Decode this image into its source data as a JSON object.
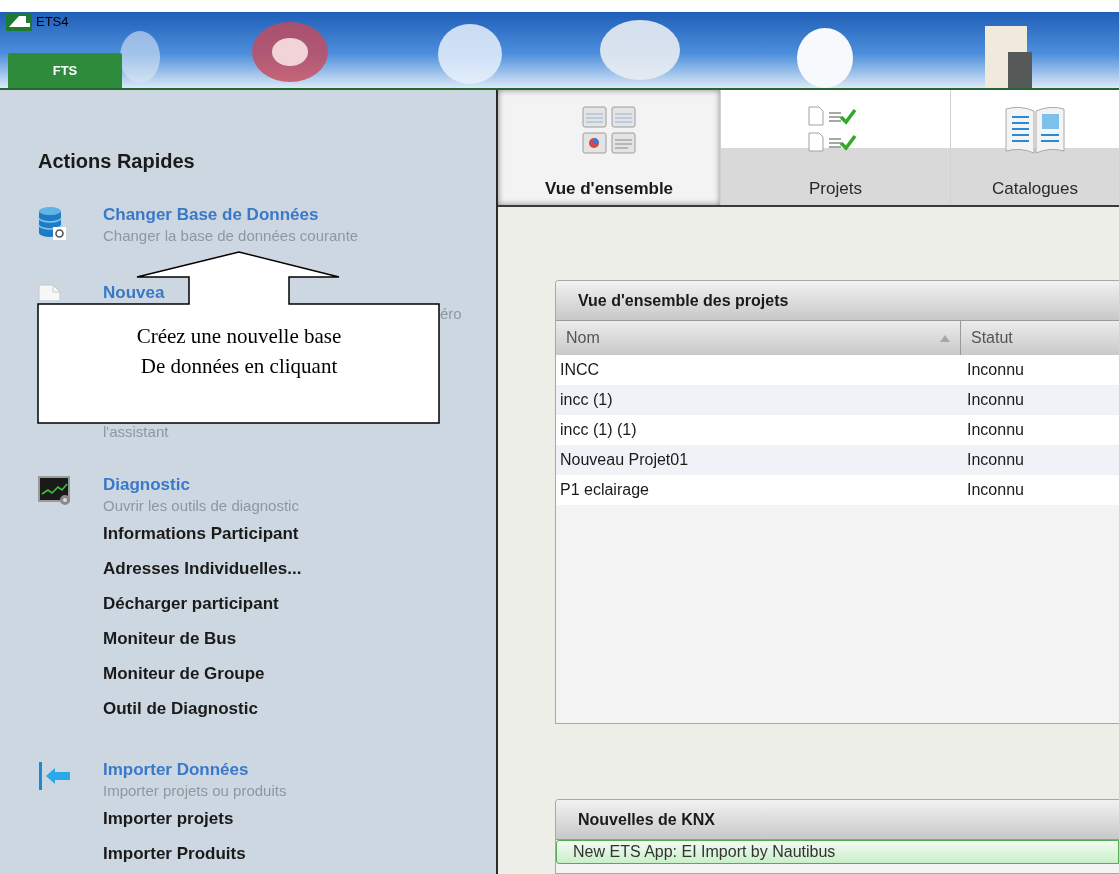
{
  "window": {
    "title": "ETS4"
  },
  "app_tab": {
    "label": "FTS",
    "selected": true
  },
  "sidebar": {
    "title": "Actions Rapides",
    "sections": [
      {
        "kind": "database",
        "title": "Changer Base de Données",
        "description": "Changer la base de données courante"
      },
      {
        "kind": "new",
        "title": "Nouvea",
        "description_end": "éro",
        "description_line_2": "l'assistant"
      },
      {
        "kind": "diagnostic",
        "title": "Diagnostic",
        "description": "Ouvrir les outils de diagnostic",
        "items": [
          "Informations Participant",
          "Adresses Individuelles...",
          "Décharger participant",
          "Moniteur de Bus",
          "Moniteur de Groupe",
          "Outil de Diagnostic"
        ]
      },
      {
        "kind": "import",
        "title": "Importer Données",
        "description": "Importer projets ou produits",
        "items": [
          "Importer projets",
          "Importer Produits"
        ]
      }
    ]
  },
  "callout": {
    "lines": [
      "Créez une nouvelle base",
      "De données en cliquant"
    ]
  },
  "tabs": [
    {
      "kind": "overview",
      "label": "Vue d'ensemble",
      "selected": true
    },
    {
      "kind": "projects",
      "label": "Projets",
      "selected": false
    },
    {
      "kind": "catalogs",
      "label": "Catalogues",
      "selected": false
    }
  ],
  "projects_panel": {
    "title": "Vue d'ensemble des projets",
    "columns": [
      {
        "label": "Nom",
        "sorted": true
      },
      {
        "label": "Statut"
      }
    ],
    "rows": [
      {
        "name": "INCC",
        "status": "Inconnu"
      },
      {
        "name": "incc (1)",
        "status": "Inconnu"
      },
      {
        "name": "incc (1) (1)",
        "status": "Inconnu"
      },
      {
        "name": "Nouveau Projet01",
        "status": "Inconnu"
      },
      {
        "name": "P1 eclairage",
        "status": "Inconnu"
      }
    ]
  },
  "news_panel": {
    "title": "Nouvelles de KNX",
    "items": [
      {
        "text": "New ETS App: EI Import by Nautibus",
        "highlighted": true
      }
    ]
  }
}
